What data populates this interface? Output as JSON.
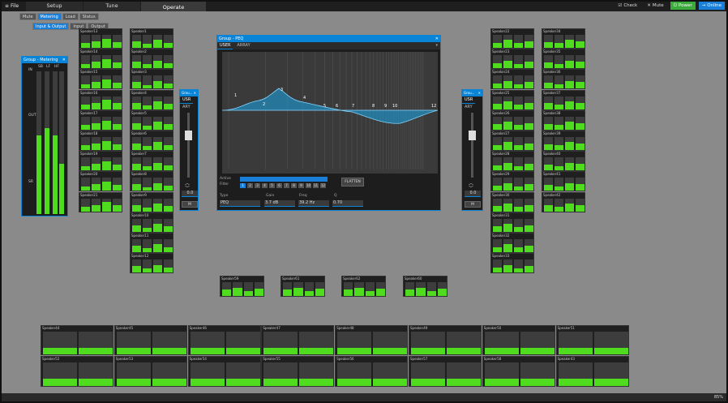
{
  "menu": {
    "file": "File",
    "tabs": [
      "Setup",
      "Tune",
      "Operate"
    ],
    "active_tab": "Operate"
  },
  "toolbar": {
    "check": "Check",
    "mute": "Mute",
    "power": "Power",
    "online": "Online"
  },
  "subnav": {
    "items": [
      "Mute",
      "Metering",
      "Load",
      "Status"
    ],
    "active": "Metering",
    "items2": [
      "Input & Output",
      "Input",
      "Output"
    ],
    "active2": "Input & Output"
  },
  "metering_window": {
    "title": "Group - Metering",
    "cols": [
      "SB",
      "LF",
      "HF"
    ],
    "in": "IN",
    "out": "OUT",
    "sr": "SR"
  },
  "peq_window": {
    "title": "Group - PEQ",
    "tabs": [
      "USER",
      "ARRAY"
    ],
    "active_label": "Active",
    "filter_label": "Filter",
    "filters": [
      "1",
      "2",
      "3",
      "4",
      "5",
      "6",
      "7",
      "8",
      "9",
      "10",
      "11",
      "12"
    ],
    "flatten": "FLATTEN",
    "type_label": "Type",
    "gain_label": "Gain",
    "freq_label": "Freq",
    "q_label": "Q",
    "type_value": "PEQ",
    "gain_value": "3.7 dB",
    "freq_value": "39.2 Hz",
    "q_value": "0.70",
    "points": [
      "1",
      "2",
      "3",
      "4",
      "5",
      "6",
      "7",
      "8",
      "9",
      "10",
      "12"
    ]
  },
  "mini_left": {
    "title": "Grou...",
    "tabs": [
      "USR",
      "ARY"
    ],
    "value": "0.0",
    "mute": "M"
  },
  "mini_right": {
    "title": "Grou...",
    "tabs": [
      "USR",
      "ARY"
    ],
    "value": "0.0",
    "mute": "M"
  },
  "speakers": {
    "col1": [
      "Speaker13",
      "Speaker14",
      "Speaker15",
      "Speaker16",
      "Speaker17",
      "Speaker18",
      "Speaker19",
      "Speaker20",
      "Speaker21"
    ],
    "col2": [
      "Speaker1",
      "Speaker2",
      "Speaker3",
      "Speaker4",
      "Speaker5",
      "Speaker6",
      "Speaker7",
      "Speaker8",
      "Speaker9",
      "Speaker10",
      "Speaker11",
      "Speaker12"
    ],
    "col3": [
      "Speaker22",
      "Speaker23",
      "Speaker24",
      "Speaker25",
      "Speaker26",
      "Speaker27",
      "Speaker28",
      "Speaker29",
      "Speaker30",
      "Speaker31",
      "Speaker32",
      "Speaker33"
    ],
    "col4": [
      "Speaker34",
      "Speaker35",
      "Speaker36",
      "Speaker37",
      "Speaker38",
      "Speaker39",
      "Speaker40",
      "Speaker41",
      "Speaker42"
    ],
    "mid": [
      "Speaker59",
      "Speaker61",
      "Speaker62",
      "Speaker60"
    ],
    "bottom1": [
      "Speaker44",
      "Speaker45",
      "Speaker46",
      "Speaker47",
      "Speaker48",
      "Speaker49",
      "Speaker50",
      "Speaker51"
    ],
    "bottom2": [
      "Speaker52",
      "Speaker53",
      "Speaker54",
      "Speaker55",
      "Speaker56",
      "Speaker57",
      "Speaker58",
      "Speaker43"
    ]
  },
  "status": {
    "zoom": "85%"
  }
}
